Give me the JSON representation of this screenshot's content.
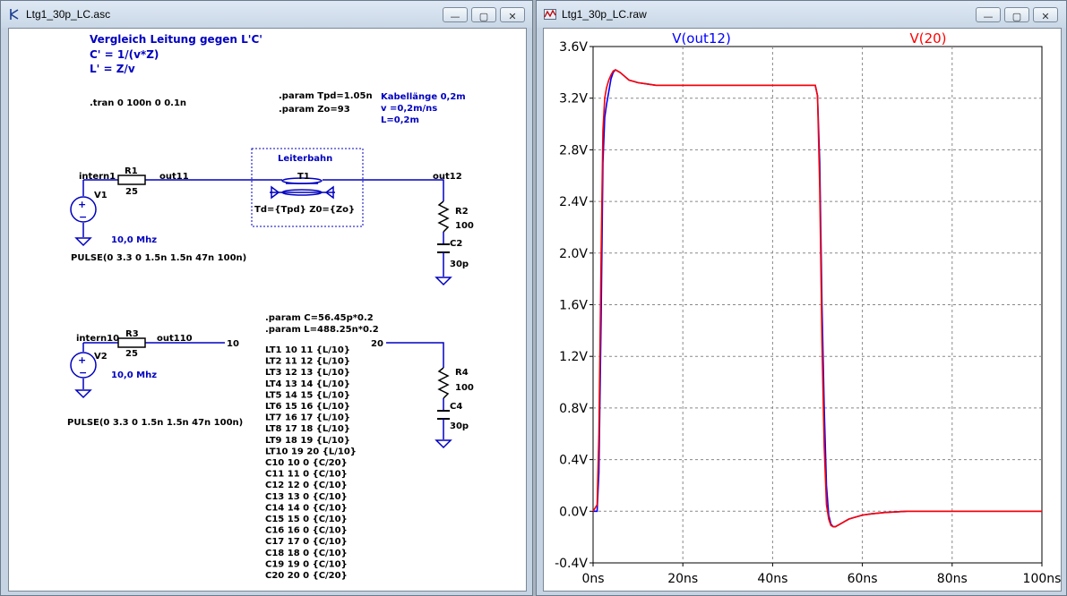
{
  "schematic_window": {
    "title": "Ltg1_30p_LC.asc",
    "min_label": "—",
    "max_label": "▢",
    "close_label": "✕",
    "comment_title": "Vergleich Leitung gegen L'C'",
    "comment_c": "C' = 1/(v*Z)",
    "comment_l": "L' = Z/v",
    "tran_directive": ".tran 0 100n 0 0.1n",
    "param_tpd": ".param Tpd=1.05n",
    "param_zo": ".param Zo=93",
    "cable_note_1": "Kabellänge 0,2m",
    "cable_note_2": "v =0,2m/ns",
    "cable_note_3": "L=0,2m",
    "leiterbahn": "Leiterbahn",
    "t1_name": "T1",
    "t1_value": "Td={Tpd} Z0={Zo}",
    "net_intern1": "intern1",
    "net_out11": "out11",
    "net_out12": "out12",
    "r1_name": "R1",
    "r1_value": "25",
    "v1_name": "V1",
    "v1_freq": "10,0 Mhz",
    "v1_pulse": "PULSE(0 3.3 0 1.5n 1.5n 47n 100n)",
    "r2_name": "R2",
    "r2_value": "100",
    "c2_name": "C2",
    "c2_value": "30p",
    "param_c": ".param C=56.45p*0.2",
    "param_l": ".param L=488.25n*0.2",
    "net_intern10": "intern10",
    "net_out110": "out110",
    "node_10": "10",
    "node_20": "20",
    "r3_name": "R3",
    "r3_value": "25",
    "v2_name": "V2",
    "v2_freq": "10,0 Mhz",
    "v2_pulse": "PULSE(0 3.3 0 1.5n 1.5n 47n 100n)",
    "r4_name": "R4",
    "r4_value": "100",
    "c4_name": "C4",
    "c4_value": "30p",
    "netlist": [
      "LT1 10 11 {L/10}",
      "LT2 11 12 {L/10}",
      "LT3 12 13 {L/10}",
      "LT4 13 14 {L/10}",
      "LT5 14 15 {L/10}",
      "LT6 15 16 {L/10}",
      "LT7 16 17 {L/10}",
      "LT8 17 18 {L/10}",
      "LT9 18 19 {L/10}",
      "LT10 19 20 {L/10}",
      "C10 10 0 {C/20}",
      "C11 11 0 {C/10}",
      "C12 12 0 {C/10}",
      "C13 13 0 {C/10}",
      "C14 14 0 {C/10}",
      "C15 15 0 {C/10}",
      "C16 16 0 {C/10}",
      "C17 17 0 {C/10}",
      "C18 18 0 {C/10}",
      "C19 19 0 {C/10}",
      "C20 20 0 {C/20}"
    ],
    "colors": {
      "wire": "#0000c0",
      "text": "#000000",
      "comment": "#0000c0"
    }
  },
  "waveform_window": {
    "title": "Ltg1_30p_LC.raw",
    "min_label": "—",
    "max_label": "▢",
    "close_label": "✕"
  },
  "chart_data": {
    "type": "line",
    "xlim": [
      0,
      100
    ],
    "ylim": [
      -0.4,
      3.6
    ],
    "x_tick_labels": [
      "0ns",
      "20ns",
      "40ns",
      "60ns",
      "80ns",
      "100ns"
    ],
    "x_ticks": [
      0,
      20,
      40,
      60,
      80,
      100
    ],
    "y_tick_labels": [
      "-0.4V",
      "0.0V",
      "0.4V",
      "0.8V",
      "1.2V",
      "1.6V",
      "2.0V",
      "2.4V",
      "2.8V",
      "3.2V",
      "3.6V"
    ],
    "y_ticks": [
      -0.4,
      0.0,
      0.4,
      0.8,
      1.2,
      1.6,
      2.0,
      2.4,
      2.8,
      3.2,
      3.6
    ],
    "grid": true,
    "series": [
      {
        "name": "V(out12)",
        "color": "#0000ff",
        "x": [
          0,
          0.9,
          1.3,
          1.8,
          2.2,
          2.6,
          3.0,
          3.5,
          4.0,
          4.5,
          5.0,
          6.0,
          7.0,
          8.0,
          9.0,
          10.0,
          12.0,
          14.0,
          16.0,
          20.0,
          30.0,
          40.0,
          49.5,
          50.0,
          50.5,
          51.0,
          51.5,
          52.0,
          52.5,
          53.0,
          53.5,
          54.0,
          55.0,
          56.0,
          57.0,
          58.0,
          60.0,
          62.0,
          65.0,
          70.0,
          80.0,
          100.0
        ],
        "y": [
          0,
          0.0,
          0.3,
          1.5,
          2.7,
          3.05,
          3.15,
          3.25,
          3.35,
          3.4,
          3.42,
          3.4,
          3.37,
          3.34,
          3.33,
          3.32,
          3.31,
          3.3,
          3.3,
          3.3,
          3.3,
          3.3,
          3.3,
          3.22,
          2.7,
          1.6,
          0.8,
          0.2,
          -0.03,
          -0.1,
          -0.12,
          -0.12,
          -0.1,
          -0.08,
          -0.06,
          -0.05,
          -0.03,
          -0.02,
          -0.01,
          0.0,
          0.0,
          0.0
        ]
      },
      {
        "name": "V(20)",
        "color": "#ff0000",
        "x": [
          0,
          0.9,
          1.3,
          1.8,
          2.2,
          2.6,
          3.0,
          3.5,
          4.0,
          4.5,
          5.0,
          6.0,
          7.0,
          8.0,
          9.0,
          10.0,
          12.0,
          14.0,
          16.0,
          20.0,
          30.0,
          40.0,
          49.5,
          50.0,
          50.5,
          51.0,
          51.5,
          52.0,
          52.5,
          53.0,
          53.5,
          54.0,
          55.0,
          56.0,
          57.0,
          58.0,
          60.0,
          62.0,
          65.0,
          70.0,
          80.0,
          100.0
        ],
        "y": [
          0,
          0.05,
          0.6,
          2.0,
          2.95,
          3.2,
          3.28,
          3.34,
          3.38,
          3.41,
          3.42,
          3.4,
          3.37,
          3.34,
          3.33,
          3.32,
          3.31,
          3.3,
          3.3,
          3.3,
          3.3,
          3.3,
          3.3,
          3.22,
          2.5,
          1.3,
          0.5,
          0.05,
          -0.06,
          -0.11,
          -0.12,
          -0.12,
          -0.1,
          -0.08,
          -0.06,
          -0.05,
          -0.03,
          -0.02,
          -0.01,
          0.0,
          0.0,
          0.0
        ]
      }
    ]
  }
}
